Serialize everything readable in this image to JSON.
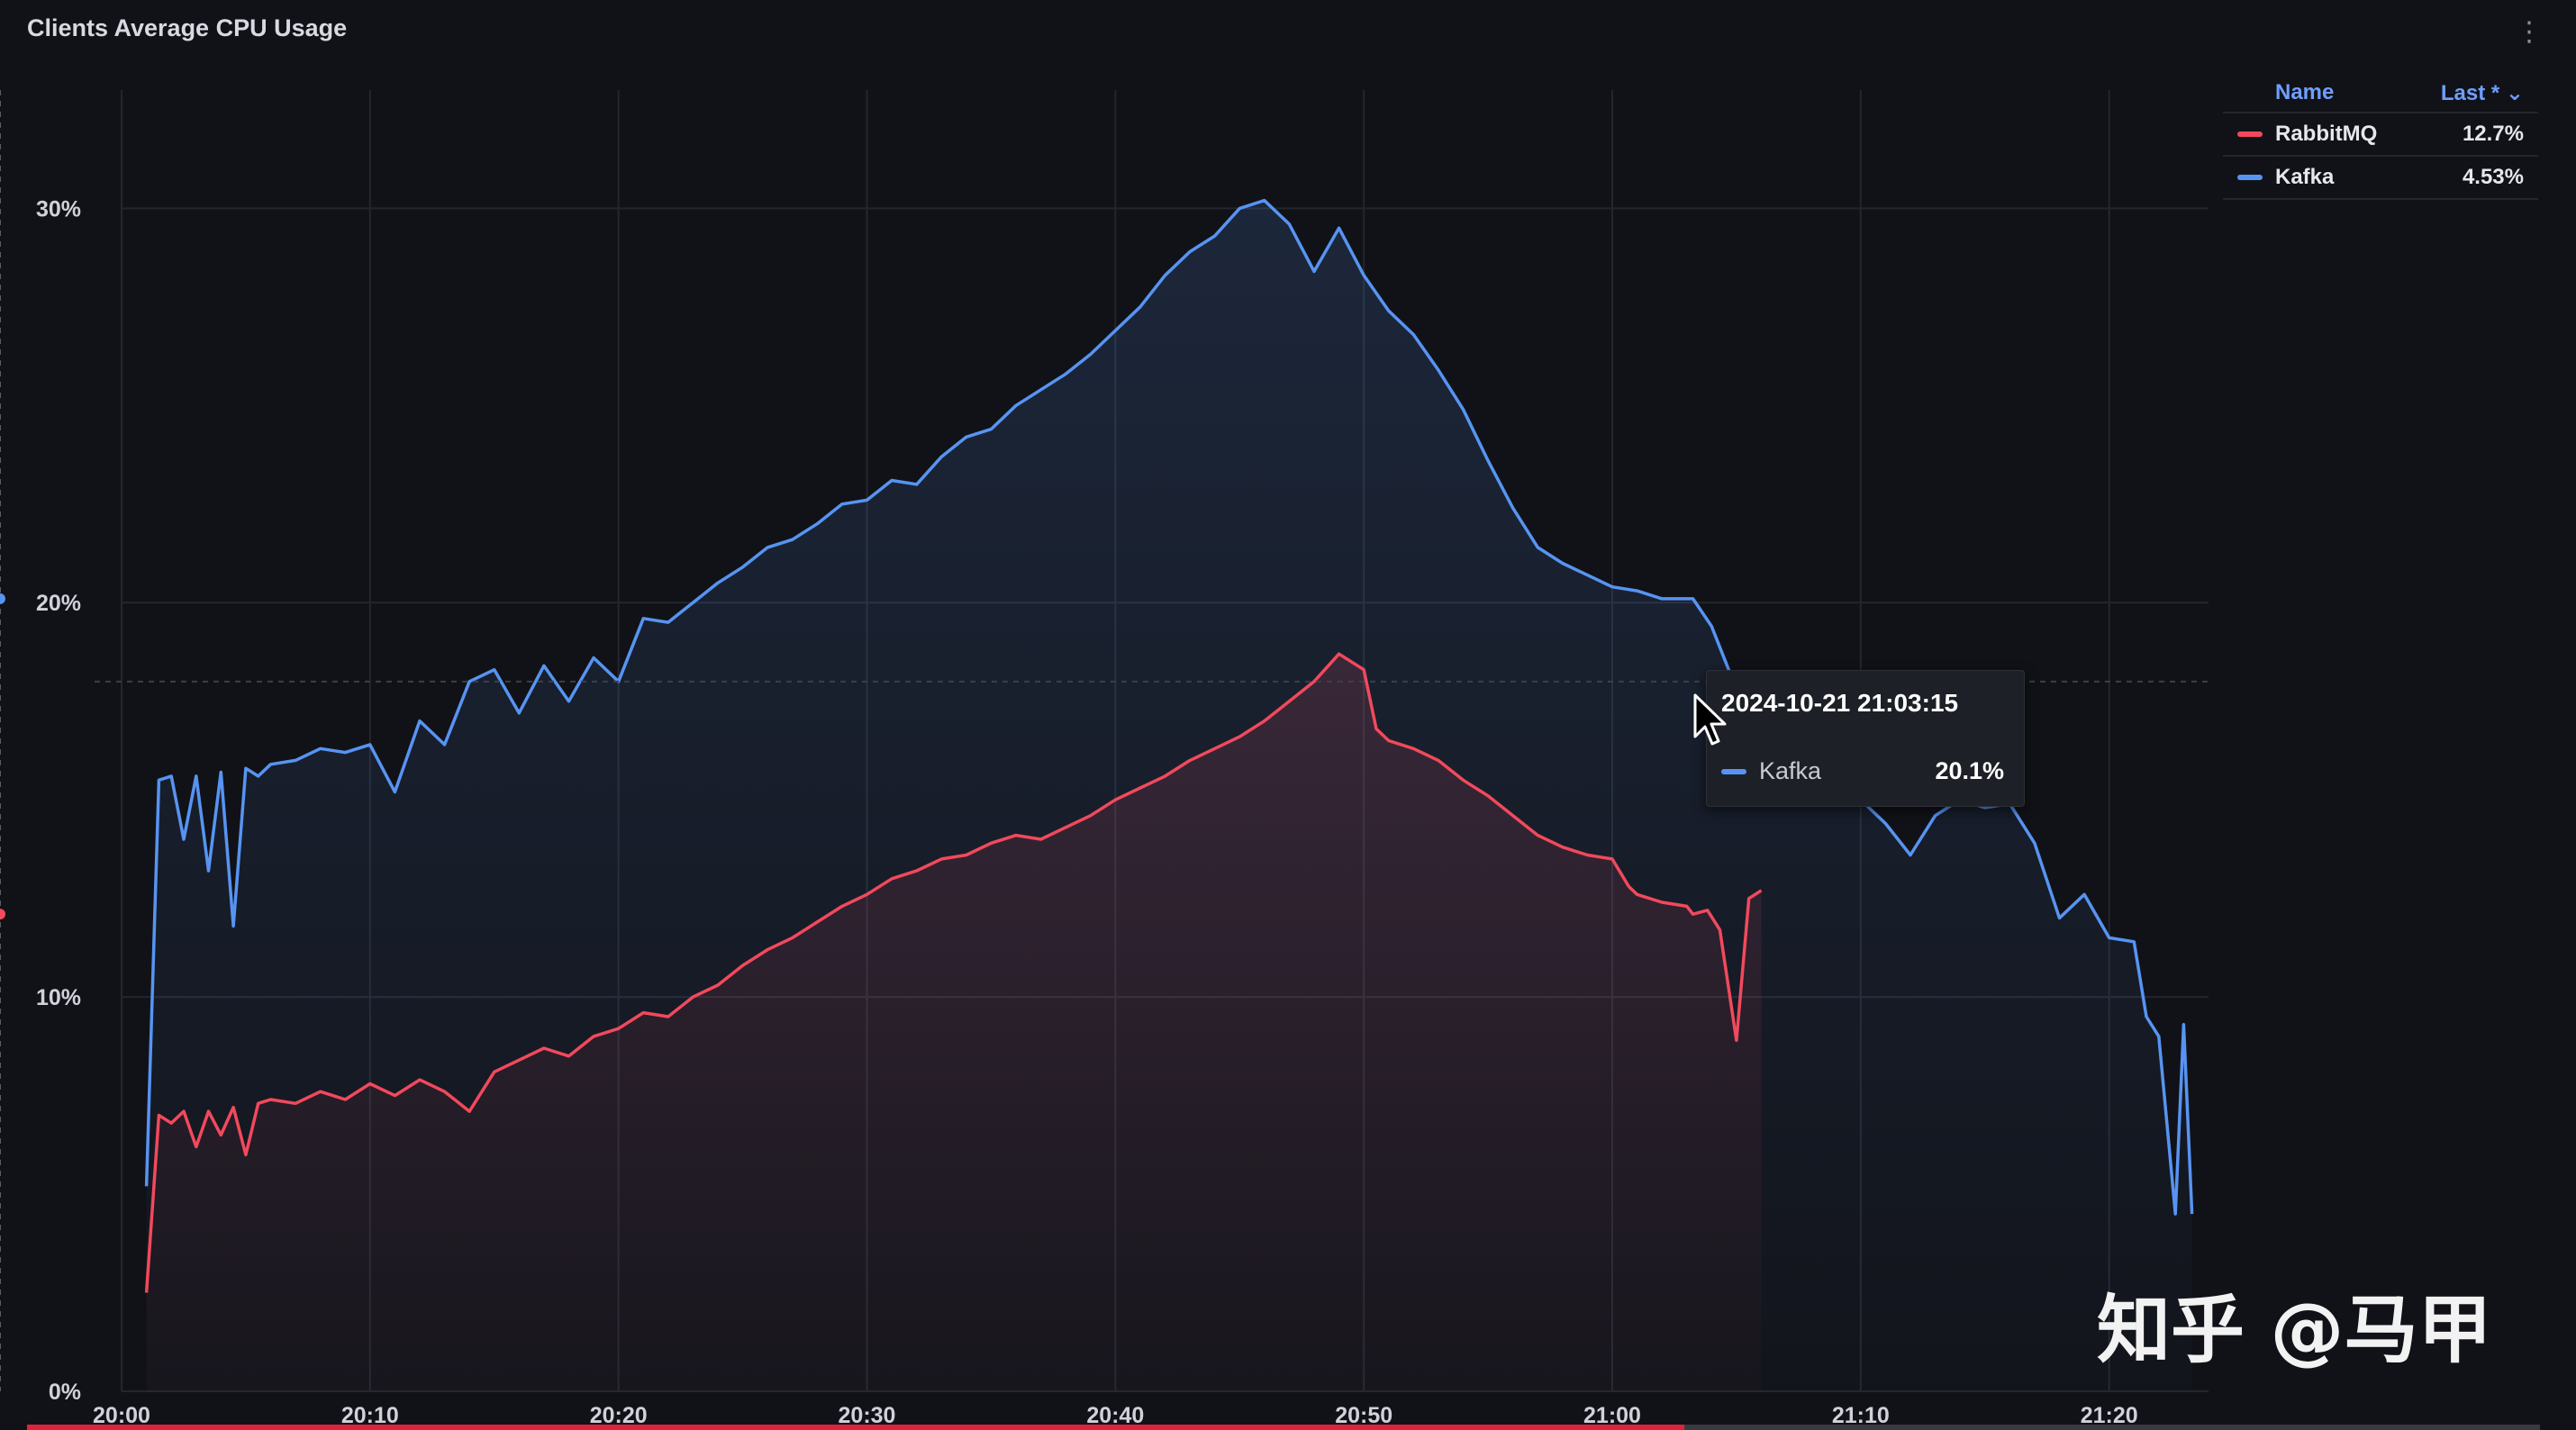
{
  "panel": {
    "title": "Clients Average CPU Usage",
    "menu_icon": "vertical-dots-icon"
  },
  "legend": {
    "name_header": "Name",
    "last_header": "Last * ⌄",
    "items": [
      {
        "name": "RabbitMQ",
        "last": "12.7%",
        "color": "#f2495c"
      },
      {
        "name": "Kafka",
        "last": "4.53%",
        "color": "#5794f2"
      }
    ]
  },
  "tooltip": {
    "time": "2024-10-21 21:03:15",
    "series": "Kafka",
    "value": "20.1%",
    "color": "#5794f2"
  },
  "watermark": "知乎 @马甲",
  "chart_data": {
    "type": "line",
    "title": "Clients Average CPU Usage",
    "x_unit": "time (2024-10-21, HH:MM)",
    "xlim": [
      "20:00",
      "21:24"
    ],
    "ylim": [
      0,
      33
    ],
    "y_ticks": [
      0,
      10,
      20,
      30
    ],
    "y_tick_labels": [
      "0%",
      "10%",
      "20%",
      "30%"
    ],
    "x_ticks": [
      "20:00",
      "20:10",
      "20:20",
      "20:30",
      "20:40",
      "20:50",
      "21:00",
      "21:10",
      "21:20"
    ],
    "grid": true,
    "legend_position": "top-right",
    "series": [
      {
        "name": "RabbitMQ",
        "color": "#f2495c",
        "points": [
          [
            "20:01",
            2.5
          ],
          [
            "20:01:30",
            7.0
          ],
          [
            "20:02",
            6.8
          ],
          [
            "20:02:30",
            7.1
          ],
          [
            "20:03",
            6.2
          ],
          [
            "20:03:30",
            7.1
          ],
          [
            "20:04",
            6.5
          ],
          [
            "20:04:30",
            7.2
          ],
          [
            "20:05",
            6.0
          ],
          [
            "20:05:30",
            7.3
          ],
          [
            "20:06",
            7.4
          ],
          [
            "20:07",
            7.3
          ],
          [
            "20:08",
            7.6
          ],
          [
            "20:09",
            7.4
          ],
          [
            "20:10",
            7.8
          ],
          [
            "20:11",
            7.5
          ],
          [
            "20:12",
            7.9
          ],
          [
            "20:13",
            7.6
          ],
          [
            "20:14",
            7.1
          ],
          [
            "20:15",
            8.1
          ],
          [
            "20:16",
            8.4
          ],
          [
            "20:17",
            8.7
          ],
          [
            "20:18",
            8.5
          ],
          [
            "20:19",
            9.0
          ],
          [
            "20:20",
            9.2
          ],
          [
            "20:21",
            9.6
          ],
          [
            "20:22",
            9.5
          ],
          [
            "20:23",
            10.0
          ],
          [
            "20:24",
            10.3
          ],
          [
            "20:25",
            10.8
          ],
          [
            "20:26",
            11.2
          ],
          [
            "20:27",
            11.5
          ],
          [
            "20:28",
            11.9
          ],
          [
            "20:29",
            12.3
          ],
          [
            "20:30",
            12.6
          ],
          [
            "20:31",
            13.0
          ],
          [
            "20:32",
            13.2
          ],
          [
            "20:33",
            13.5
          ],
          [
            "20:34",
            13.6
          ],
          [
            "20:35",
            13.9
          ],
          [
            "20:36",
            14.1
          ],
          [
            "20:37",
            14.0
          ],
          [
            "20:38",
            14.3
          ],
          [
            "20:39",
            14.6
          ],
          [
            "20:40",
            15.0
          ],
          [
            "20:41",
            15.3
          ],
          [
            "20:42",
            15.6
          ],
          [
            "20:43",
            16.0
          ],
          [
            "20:44",
            16.3
          ],
          [
            "20:45",
            16.6
          ],
          [
            "20:46",
            17.0
          ],
          [
            "20:47",
            17.5
          ],
          [
            "20:48",
            18.0
          ],
          [
            "20:49",
            18.7
          ],
          [
            "20:50",
            18.3
          ],
          [
            "20:50:30",
            16.8
          ],
          [
            "20:51",
            16.5
          ],
          [
            "20:52",
            16.3
          ],
          [
            "20:53",
            16.0
          ],
          [
            "20:54",
            15.5
          ],
          [
            "20:55",
            15.1
          ],
          [
            "20:56",
            14.6
          ],
          [
            "20:57",
            14.1
          ],
          [
            "20:58",
            13.8
          ],
          [
            "20:59",
            13.6
          ],
          [
            "21:00",
            13.5
          ],
          [
            "21:00:40",
            12.8
          ],
          [
            "21:01",
            12.6
          ],
          [
            "21:02",
            12.4
          ],
          [
            "21:03",
            12.3
          ],
          [
            "21:03:15",
            12.1
          ],
          [
            "21:03:50",
            12.2
          ],
          [
            "21:04:20",
            11.7
          ],
          [
            "21:05",
            8.9
          ],
          [
            "21:05:30",
            12.5
          ],
          [
            "21:06",
            12.7
          ]
        ]
      },
      {
        "name": "Kafka",
        "color": "#5794f2",
        "points": [
          [
            "20:01",
            5.2
          ],
          [
            "20:01:30",
            15.5
          ],
          [
            "20:02",
            15.6
          ],
          [
            "20:02:30",
            14.0
          ],
          [
            "20:03",
            15.6
          ],
          [
            "20:03:30",
            13.2
          ],
          [
            "20:04",
            15.7
          ],
          [
            "20:04:30",
            11.8
          ],
          [
            "20:05",
            15.8
          ],
          [
            "20:05:30",
            15.6
          ],
          [
            "20:06",
            15.9
          ],
          [
            "20:07",
            16.0
          ],
          [
            "20:08",
            16.3
          ],
          [
            "20:09",
            16.2
          ],
          [
            "20:10",
            16.4
          ],
          [
            "20:11",
            15.2
          ],
          [
            "20:12",
            17.0
          ],
          [
            "20:13",
            16.4
          ],
          [
            "20:14",
            18.0
          ],
          [
            "20:15",
            18.3
          ],
          [
            "20:16",
            17.2
          ],
          [
            "20:17",
            18.4
          ],
          [
            "20:18",
            17.5
          ],
          [
            "20:19",
            18.6
          ],
          [
            "20:20",
            18.0
          ],
          [
            "20:21",
            19.6
          ],
          [
            "20:22",
            19.5
          ],
          [
            "20:23",
            20.0
          ],
          [
            "20:24",
            20.5
          ],
          [
            "20:25",
            20.9
          ],
          [
            "20:26",
            21.4
          ],
          [
            "20:27",
            21.6
          ],
          [
            "20:28",
            22.0
          ],
          [
            "20:29",
            22.5
          ],
          [
            "20:30",
            22.6
          ],
          [
            "20:31",
            23.1
          ],
          [
            "20:32",
            23.0
          ],
          [
            "20:33",
            23.7
          ],
          [
            "20:34",
            24.2
          ],
          [
            "20:35",
            24.4
          ],
          [
            "20:36",
            25.0
          ],
          [
            "20:37",
            25.4
          ],
          [
            "20:38",
            25.8
          ],
          [
            "20:39",
            26.3
          ],
          [
            "20:40",
            26.9
          ],
          [
            "20:41",
            27.5
          ],
          [
            "20:42",
            28.3
          ],
          [
            "20:43",
            28.9
          ],
          [
            "20:44",
            29.3
          ],
          [
            "20:45",
            30.0
          ],
          [
            "20:46",
            30.2
          ],
          [
            "20:47",
            29.6
          ],
          [
            "20:48",
            28.4
          ],
          [
            "20:49",
            29.5
          ],
          [
            "20:50",
            28.3
          ],
          [
            "20:51",
            27.4
          ],
          [
            "20:52",
            26.8
          ],
          [
            "20:53",
            25.9
          ],
          [
            "20:54",
            24.9
          ],
          [
            "20:55",
            23.6
          ],
          [
            "20:56",
            22.4
          ],
          [
            "20:57",
            21.4
          ],
          [
            "20:58",
            21.0
          ],
          [
            "20:59",
            20.7
          ],
          [
            "21:00",
            20.4
          ],
          [
            "21:01",
            20.3
          ],
          [
            "21:02",
            20.1
          ],
          [
            "21:03:15",
            20.1
          ],
          [
            "21:04",
            19.4
          ],
          [
            "21:05",
            17.8
          ],
          [
            "21:06",
            16.6
          ],
          [
            "21:07",
            16.2
          ],
          [
            "21:08",
            15.7
          ],
          [
            "21:09",
            15.2
          ],
          [
            "21:10",
            15.0
          ],
          [
            "21:11",
            14.4
          ],
          [
            "21:12",
            13.6
          ],
          [
            "21:13",
            14.6
          ],
          [
            "21:14",
            15.0
          ],
          [
            "21:15",
            14.8
          ],
          [
            "21:16",
            14.9
          ],
          [
            "21:17",
            13.9
          ],
          [
            "21:18",
            12.0
          ],
          [
            "21:19",
            12.6
          ],
          [
            "21:20",
            11.5
          ],
          [
            "21:21",
            11.4
          ],
          [
            "21:21:30",
            9.5
          ],
          [
            "21:22",
            9.0
          ],
          [
            "21:22:40",
            4.5
          ],
          [
            "21:23",
            9.3
          ],
          [
            "21:23:20",
            4.5
          ]
        ]
      }
    ]
  }
}
